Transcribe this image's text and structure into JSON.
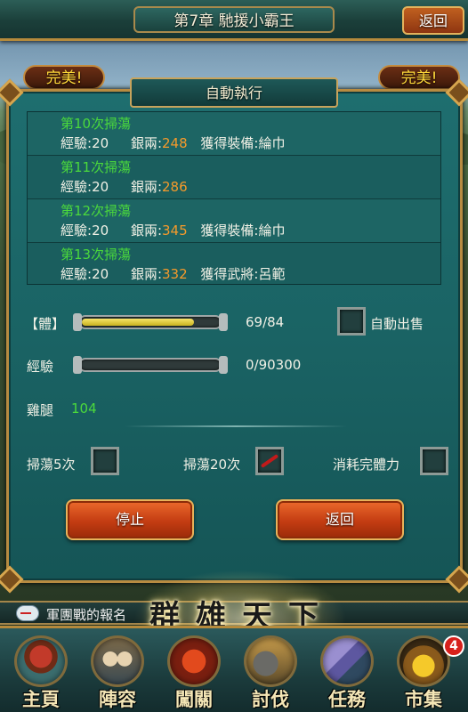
{
  "header": {
    "chapter_title": "第7章 馳援小霸王",
    "back_label": "返回"
  },
  "perfect_left": "完美!",
  "perfect_right": "完美!",
  "dialog": {
    "title": "自動執行",
    "log": [
      {
        "round": "第10次掃蕩",
        "exp_label": "經驗:",
        "exp": "20",
        "silver_label": "銀兩:",
        "silver": "248",
        "reward": "獲得裝備:綸巾"
      },
      {
        "round": "第11次掃蕩",
        "exp_label": "經驗:",
        "exp": "20",
        "silver_label": "銀兩:",
        "silver": "286",
        "reward": ""
      },
      {
        "round": "第12次掃蕩",
        "exp_label": "經驗:",
        "exp": "20",
        "silver_label": "銀兩:",
        "silver": "345",
        "reward": "獲得裝備:綸巾"
      },
      {
        "round": "第13次掃蕩",
        "exp_label": "經驗:",
        "exp": "20",
        "silver_label": "銀兩:",
        "silver": "332",
        "reward": "獲得武將:呂範"
      }
    ],
    "stamina_label": "【體】",
    "stamina_value": "69/84",
    "stamina_fraction": 0.82,
    "exp_label": "經驗",
    "exp_value": "0/90300",
    "exp_fraction": 0,
    "auto_sell_label": "自動出售",
    "chicken_label": "雞腿",
    "chicken_value": "104",
    "options": [
      {
        "label": "掃蕩5次",
        "checked": false
      },
      {
        "label": "掃蕩20次",
        "checked": true
      },
      {
        "label": "消耗完體力",
        "checked": false
      }
    ],
    "stop_label": "停止",
    "back_label": "返回"
  },
  "ticker": {
    "text": "軍團戰的報名"
  },
  "banner": "群雄天下",
  "nav": [
    {
      "label": "主頁",
      "icon": "palace-icon"
    },
    {
      "label": "陣容",
      "icon": "generals-icon"
    },
    {
      "label": "闖關",
      "icon": "battle-icon"
    },
    {
      "label": "討伐",
      "icon": "army-icon"
    },
    {
      "label": "任務",
      "icon": "scroll-icon"
    },
    {
      "label": "市集",
      "icon": "treasure-chest-icon"
    }
  ],
  "market_badge": "4"
}
